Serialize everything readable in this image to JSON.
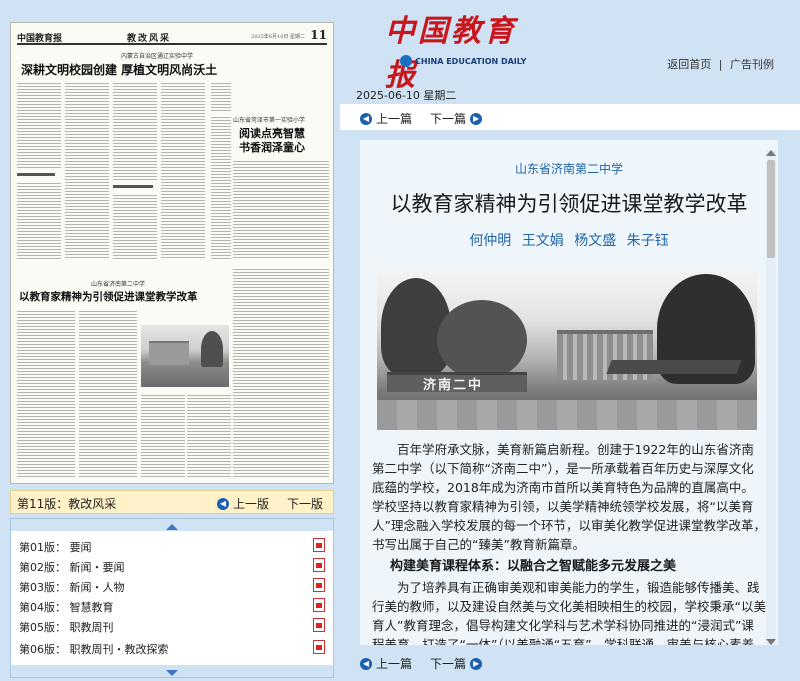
{
  "paper_preview": {
    "masthead_name": "中国教育报",
    "masthead_column": "教改风采",
    "masthead_page_no": "11",
    "masthead_date": "2025年6月10日 星期二",
    "top_kicker": "内蒙古自治区通辽实验中学",
    "top_headline": "深耕文明校园创建 厚植文明风尚沃土",
    "right_kicker": "山东省菏泽市第一实验小学",
    "right_headline_1": "阅读点亮智慧",
    "right_headline_2": "书香润泽童心",
    "mid_kicker": "山东省济南第二中学",
    "mid_headline": "以教育家精神为引领促进课堂教学改革"
  },
  "issue_bar": {
    "current": "第11版：教改风采",
    "prev": "上一版",
    "next": "下一版"
  },
  "sections": [
    {
      "label": "第01版： 要闻"
    },
    {
      "label": "第02版： 新闻・要闻"
    },
    {
      "label": "第03版： 新闻・人物"
    },
    {
      "label": "第04版： 智慧教育"
    },
    {
      "label": "第05版： 职教周刊"
    },
    {
      "label": "第06版： 职教周刊・教改探索"
    }
  ],
  "header": {
    "logo_text": "中国教育报",
    "logo_en": "CHINA EDUCATION DAILY",
    "link_home": "返回首页",
    "link_sep": "|",
    "link_ad": "广告刊例",
    "date": "2025-06-10 星期二"
  },
  "nav": {
    "prev": "上一篇",
    "next": "下一篇"
  },
  "article": {
    "kicker": "山东省济南第二中学",
    "title": "以教育家精神为引领促进课堂教学改革",
    "authors": "何仲明 王文娟 杨文盛 朱子钰",
    "photo_gate_text": "济南二中",
    "para1": "百年学府承文脉，美育新篇启新程。创建于1922年的山东省济南第二中学（以下简称“济南二中”），是一所承载着百年历史与深厚文化底蕴的学校，2018年成为济南市首所以美育特色为品牌的直属高中。学校坚持以教育家精神为引领，以美学精神统领学校发展，将“以美育人”理念融入学校发展的每一个环节，以审美化教学促进课堂教学改革，书写出属于自己的“臻美”教育新篇章。",
    "section_title": "构建美育课程体系：以融合之智赋能多元发展之美",
    "para2": "为了培养具有正确审美观和审美能力的学生，锻造能够传播美、践行美的教师，以及建设自然美与文化美相映相生的校园，学校秉承“以美育人”教育理念，倡导构建文化学科与艺术学科协同推进的“浸润式”课程美育，打造了“一体”（以美融通“五育”，学科联通、审美与核心素养"
  },
  "colors": {
    "background": "#cfe3f4",
    "logo_red": "#c8161d",
    "accent_blue": "#1f64a6",
    "issue_bar": "#fff1c8"
  }
}
